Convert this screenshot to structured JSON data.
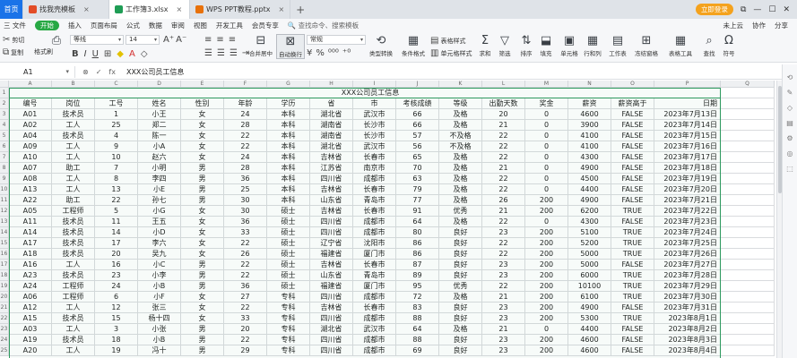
{
  "tabs": [
    {
      "label": "首页",
      "kind": "home"
    },
    {
      "label": "找我壳模板",
      "kind": "doc",
      "color": "#e34c26"
    },
    {
      "label": "工作簿3.xlsx",
      "kind": "active",
      "color": "#1f9d55"
    },
    {
      "label": "WPS PPT教程.pptx",
      "kind": "doc",
      "color": "#e8710a"
    }
  ],
  "tab_right": {
    "login": "立即登录",
    "icons": [
      "⧉",
      "—",
      "☐",
      "✕"
    ]
  },
  "menubar": {
    "file": "三 文件",
    "start": "开始",
    "items": [
      "插入",
      "页面布局",
      "公式",
      "数据",
      "审阅",
      "视图",
      "开发工具",
      "会员专享"
    ],
    "search": "查找命令、搜索模板",
    "right": [
      "未上云",
      "协作",
      "分享"
    ]
  },
  "ribbon": {
    "cut": "剪切",
    "copy": "复制",
    "format_painter": "格式刷",
    "paste": "粘贴",
    "font_name": "等线",
    "font_size": "14",
    "merge": "合并居中",
    "wrap": "自动换行",
    "number_format": "常规",
    "type_convert": "类型转换",
    "cond_format": "条件格式",
    "table_style": "表格样式",
    "cell_style": "单元格样式",
    "sum": "求和",
    "filter": "筛选",
    "sort": "排序",
    "fill": "填充",
    "cell": "单元格",
    "rowcol": "行和列",
    "worksheet": "工作表",
    "freeze": "冻结窗格",
    "table_tool": "表格工具",
    "find": "查找",
    "symbol": "符号"
  },
  "formula_bar": {
    "name_box": "A1",
    "fx_icons": [
      "⊗",
      "✓",
      "fx"
    ],
    "content": "XXX公司员工信息"
  },
  "columns": [
    "A",
    "B",
    "C",
    "D",
    "E",
    "F",
    "G",
    "H",
    "I",
    "J",
    "K",
    "L",
    "M",
    "N",
    "O",
    "P",
    "Q"
  ],
  "title": "XXX公司员工信息",
  "headers": [
    "编号",
    "岗位",
    "工号",
    "姓名",
    "性别",
    "年龄",
    "学历",
    "省",
    "市",
    "考核成绩",
    "等级",
    "出勤天数",
    "奖金",
    "薪资",
    "薪资高于",
    "日期"
  ],
  "rows": [
    [
      "A01",
      "技术员",
      "1",
      "小王",
      "女",
      "24",
      "本科",
      "湖北省",
      "武汉市",
      "66",
      "及格",
      "20",
      "0",
      "4600",
      "FALSE",
      "2023年7月13日"
    ],
    [
      "A02",
      "工人",
      "25",
      "郑二",
      "女",
      "28",
      "本科",
      "湖南省",
      "长沙市",
      "66",
      "及格",
      "21",
      "0",
      "3900",
      "FALSE",
      "2023年7月14日"
    ],
    [
      "A04",
      "技术员",
      "4",
      "陈一",
      "女",
      "22",
      "本科",
      "湖南省",
      "长沙市",
      "57",
      "不及格",
      "22",
      "0",
      "4100",
      "FALSE",
      "2023年7月15日"
    ],
    [
      "A09",
      "工人",
      "9",
      "小A",
      "女",
      "22",
      "本科",
      "湖北省",
      "武汉市",
      "56",
      "不及格",
      "22",
      "0",
      "4100",
      "FALSE",
      "2023年7月16日"
    ],
    [
      "A10",
      "工人",
      "10",
      "赵六",
      "女",
      "24",
      "本科",
      "吉林省",
      "长春市",
      "65",
      "及格",
      "22",
      "0",
      "4300",
      "FALSE",
      "2023年7月17日"
    ],
    [
      "A07",
      "助工",
      "7",
      "小明",
      "男",
      "28",
      "本科",
      "江苏省",
      "南京市",
      "70",
      "及格",
      "21",
      "0",
      "4900",
      "FALSE",
      "2023年7月18日"
    ],
    [
      "A08",
      "工人",
      "8",
      "李四",
      "男",
      "36",
      "本科",
      "四川省",
      "成都市",
      "63",
      "及格",
      "22",
      "0",
      "4500",
      "FALSE",
      "2023年7月19日"
    ],
    [
      "A13",
      "工人",
      "13",
      "小E",
      "男",
      "25",
      "本科",
      "吉林省",
      "长春市",
      "79",
      "及格",
      "22",
      "0",
      "4400",
      "FALSE",
      "2023年7月20日"
    ],
    [
      "A22",
      "助工",
      "22",
      "孙七",
      "男",
      "30",
      "本科",
      "山东省",
      "青岛市",
      "77",
      "及格",
      "26",
      "200",
      "4900",
      "FALSE",
      "2023年7月21日"
    ],
    [
      "A05",
      "工程师",
      "5",
      "小G",
      "女",
      "30",
      "硕士",
      "吉林省",
      "长春市",
      "91",
      "优秀",
      "21",
      "200",
      "6200",
      "TRUE",
      "2023年7月22日"
    ],
    [
      "A11",
      "技术员",
      "11",
      "王五",
      "女",
      "36",
      "硕士",
      "四川省",
      "成都市",
      "64",
      "及格",
      "22",
      "0",
      "4300",
      "FALSE",
      "2023年7月23日"
    ],
    [
      "A14",
      "技术员",
      "14",
      "小D",
      "女",
      "33",
      "硕士",
      "四川省",
      "成都市",
      "80",
      "良好",
      "23",
      "200",
      "5100",
      "TRUE",
      "2023年7月24日"
    ],
    [
      "A17",
      "技术员",
      "17",
      "李六",
      "女",
      "22",
      "硕士",
      "辽宁省",
      "沈阳市",
      "86",
      "良好",
      "22",
      "200",
      "5200",
      "TRUE",
      "2023年7月25日"
    ],
    [
      "A18",
      "技术员",
      "20",
      "吴九",
      "女",
      "26",
      "硕士",
      "福建省",
      "厦门市",
      "86",
      "良好",
      "22",
      "200",
      "5000",
      "TRUE",
      "2023年7月26日"
    ],
    [
      "A16",
      "工人",
      "16",
      "小C",
      "男",
      "22",
      "硕士",
      "吉林省",
      "长春市",
      "87",
      "良好",
      "23",
      "200",
      "5000",
      "FALSE",
      "2023年7月27日"
    ],
    [
      "A23",
      "技术员",
      "23",
      "小李",
      "男",
      "22",
      "硕士",
      "山东省",
      "青岛市",
      "89",
      "良好",
      "23",
      "200",
      "6000",
      "TRUE",
      "2023年7月28日"
    ],
    [
      "A24",
      "工程师",
      "24",
      "小B",
      "男",
      "36",
      "硕士",
      "福建省",
      "厦门市",
      "95",
      "优秀",
      "22",
      "200",
      "10100",
      "TRUE",
      "2023年7月29日"
    ],
    [
      "A06",
      "工程师",
      "6",
      "小F",
      "女",
      "27",
      "专科",
      "四川省",
      "成都市",
      "72",
      "及格",
      "21",
      "200",
      "6100",
      "TRUE",
      "2023年7月30日"
    ],
    [
      "A12",
      "工人",
      "12",
      "张三",
      "女",
      "22",
      "专科",
      "吉林省",
      "长春市",
      "83",
      "良好",
      "23",
      "200",
      "4900",
      "FALSE",
      "2023年7月31日"
    ],
    [
      "A15",
      "技术员",
      "15",
      "杨十四",
      "女",
      "33",
      "专科",
      "四川省",
      "成都市",
      "88",
      "良好",
      "23",
      "200",
      "5300",
      "TRUE",
      "2023年8月1日"
    ],
    [
      "A03",
      "工人",
      "3",
      "小张",
      "男",
      "20",
      "专科",
      "湖北省",
      "武汉市",
      "64",
      "及格",
      "21",
      "0",
      "4400",
      "FALSE",
      "2023年8月2日"
    ],
    [
      "A19",
      "技术员",
      "18",
      "小B",
      "男",
      "22",
      "专科",
      "四川省",
      "成都市",
      "88",
      "良好",
      "23",
      "200",
      "4600",
      "FALSE",
      "2023年8月3日"
    ],
    [
      "A20",
      "工人",
      "19",
      "冯十",
      "男",
      "29",
      "专科",
      "四川省",
      "成都市",
      "69",
      "良好",
      "23",
      "200",
      "4600",
      "FALSE",
      "2023年8月4日"
    ]
  ],
  "sidebar_icons": [
    "⟲",
    "✎",
    "◇",
    "▤",
    "⚙",
    "◎",
    "⬚"
  ]
}
